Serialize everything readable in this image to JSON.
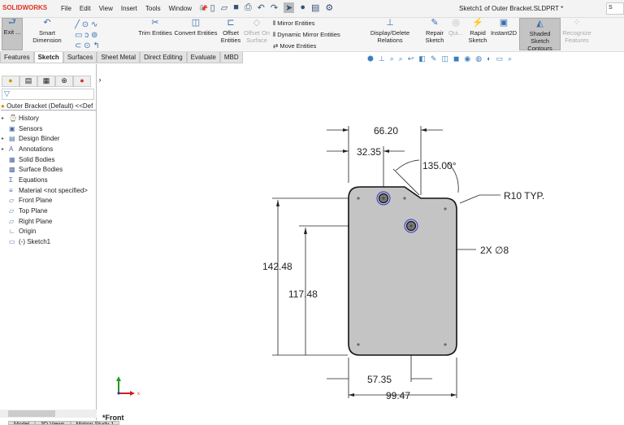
{
  "app": {
    "logo": "SOLIDWORKS",
    "title": "Sketch1 of Outer Bracket.SLDPRT *",
    "search_hint": "S"
  },
  "menu": [
    "File",
    "Edit",
    "View",
    "Insert",
    "Tools",
    "Window"
  ],
  "ribbon": {
    "exit": "Exit ...",
    "smart_dimension": "Smart Dimension",
    "trim": "Trim Entities",
    "convert": "Convert Entities",
    "offset": "Offset Entities",
    "offset_surface": "Offset On Surface",
    "mirror": "Mirror Entities",
    "dynamic_mirror": "Dynamic Mirror Entities",
    "move": "Move Entities",
    "display_relations": "Display/Delete Relations",
    "repair": "Repair Sketch",
    "quick": "Qui...",
    "rapid": "Rapid Sketch",
    "instant2d": "Instant2D",
    "shaded": "Shaded Sketch Contours",
    "recognize": "Recognize Features"
  },
  "tabs": [
    "Features",
    "Sketch",
    "Surfaces",
    "Sheet Metal",
    "Direct Editing",
    "Evaluate",
    "MBD"
  ],
  "tree": {
    "root": "Outer Bracket (Default) <<Def",
    "items": [
      {
        "label": "History",
        "expand": true
      },
      {
        "label": "Sensors",
        "expand": false
      },
      {
        "label": "Design Binder",
        "expand": true
      },
      {
        "label": "Annotations",
        "expand": true
      },
      {
        "label": "Solid Bodies",
        "expand": false
      },
      {
        "label": "Surface Bodies",
        "expand": false
      },
      {
        "label": "Equations",
        "expand": false
      },
      {
        "label": "Material <not specified>",
        "expand": false
      },
      {
        "label": "Front Plane",
        "expand": false
      },
      {
        "label": "Top Plane",
        "expand": false
      },
      {
        "label": "Right Plane",
        "expand": false
      },
      {
        "label": "Origin",
        "expand": false
      },
      {
        "label": "(-) Sketch1",
        "expand": false
      }
    ]
  },
  "bottom_tabs": [
    "Model",
    "3D Views",
    "Motion Study 1"
  ],
  "view_name": "*Front",
  "drawing": {
    "dims": {
      "d1": "66.20",
      "d2": "32.35",
      "angle": "135.00°",
      "radius": "R10 TYP.",
      "holes": "2X ∅8",
      "h1": "142.48",
      "h2": "117.48",
      "w1": "57.35",
      "w2": "99.47"
    },
    "axis_x": "x"
  }
}
